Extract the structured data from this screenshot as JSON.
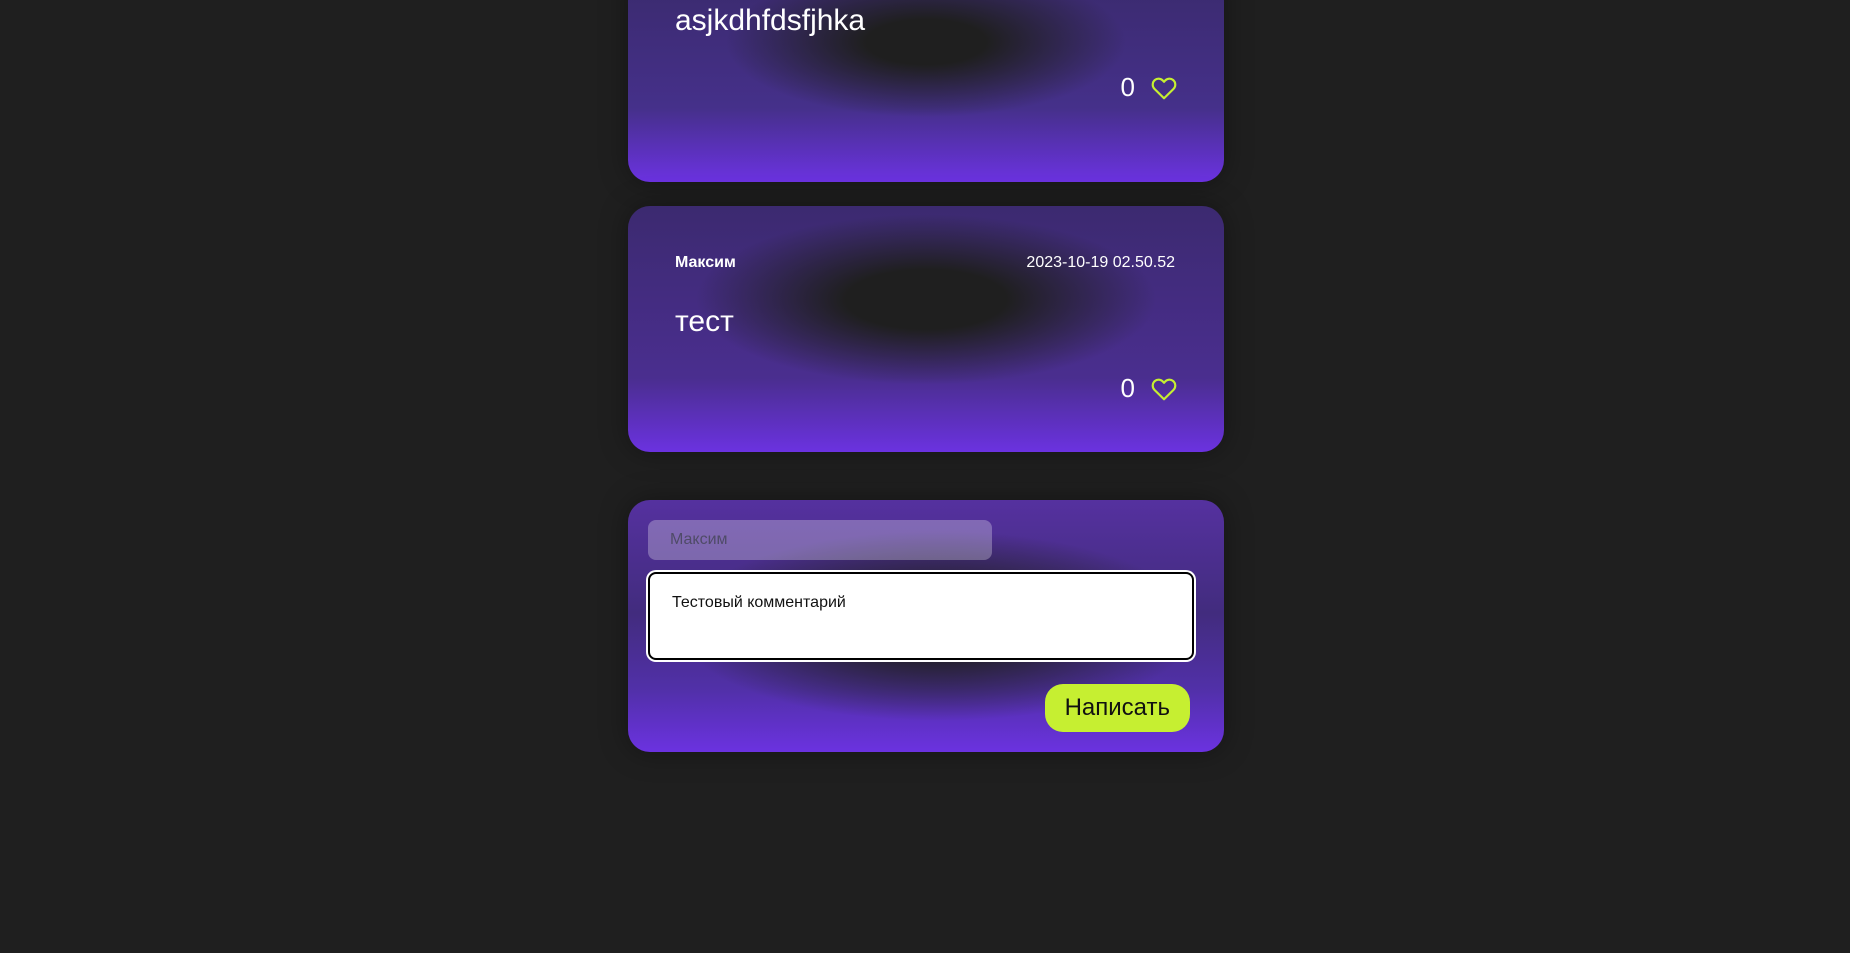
{
  "posts": [
    {
      "author": "",
      "date": "",
      "message": "asjkdhfdsfjhka",
      "likes": "0",
      "icon": "heart-outline-icon"
    },
    {
      "author": "Максим",
      "date": "2023-10-19 02.50.52",
      "message": "тест",
      "likes": "0",
      "icon": "heart-outline-icon"
    }
  ],
  "form": {
    "name_placeholder": "Максим",
    "name_value": "",
    "comment_value": "Тестовый комментарий",
    "submit_label": "Написать"
  },
  "colors": {
    "background": "#1f1f1f",
    "card_purple": "#6b32e0",
    "accent_lime": "#c6ef31",
    "heart": "#c6ef31"
  }
}
